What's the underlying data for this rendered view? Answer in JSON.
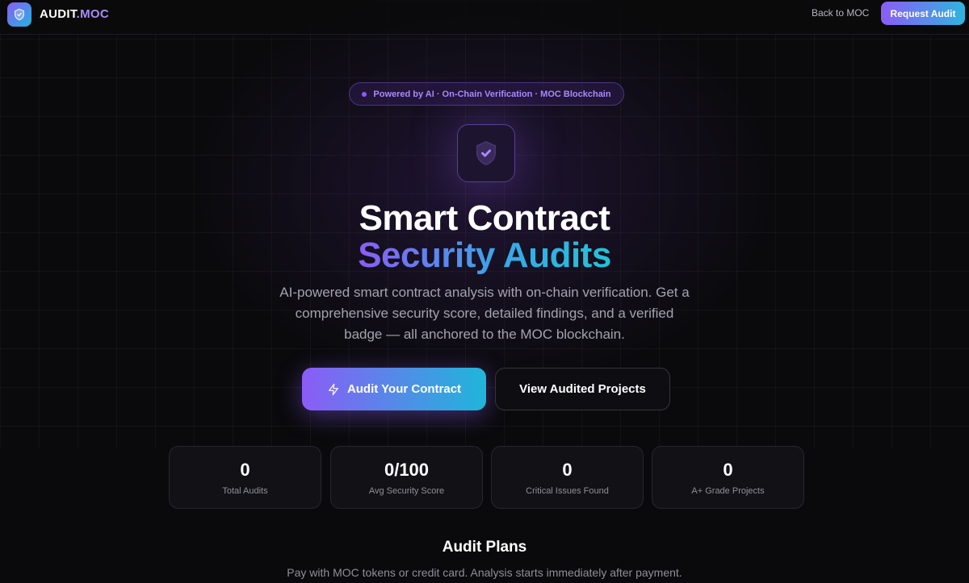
{
  "nav": {
    "brand_part1": "AUDIT",
    "brand_part2": ".MOC",
    "back_link": "Back to MOC",
    "request_button": "Request Audit"
  },
  "hero": {
    "pill_text": "Powered by AI · On-Chain Verification · MOC Blockchain",
    "title_line1": "Smart Contract",
    "title_line2": "Security Audits",
    "subtitle": "AI-powered smart contract analysis with on-chain verification. Get a comprehensive security score, detailed findings, and a verified badge — all anchored to the MOC blockchain.",
    "primary_button": "Audit Your Contract",
    "secondary_button": "View Audited Projects"
  },
  "stats": [
    {
      "value": "0",
      "label": "Total Audits"
    },
    {
      "value": "0/100",
      "label": "Avg Security Score"
    },
    {
      "value": "0",
      "label": "Critical Issues Found"
    },
    {
      "value": "0",
      "label": "A+ Grade Projects"
    }
  ],
  "plans": {
    "title": "Audit Plans",
    "subtitle": "Pay with MOC tokens or credit card. Analysis starts immediately after payment."
  },
  "colors": {
    "background": "#0a0a0c",
    "accent_purple": "#8b5cf6",
    "accent_cyan": "#22b5e0"
  },
  "icons": {
    "logo": "shield-check-icon",
    "hero": "shield-check-icon",
    "cta": "lightning-icon"
  }
}
